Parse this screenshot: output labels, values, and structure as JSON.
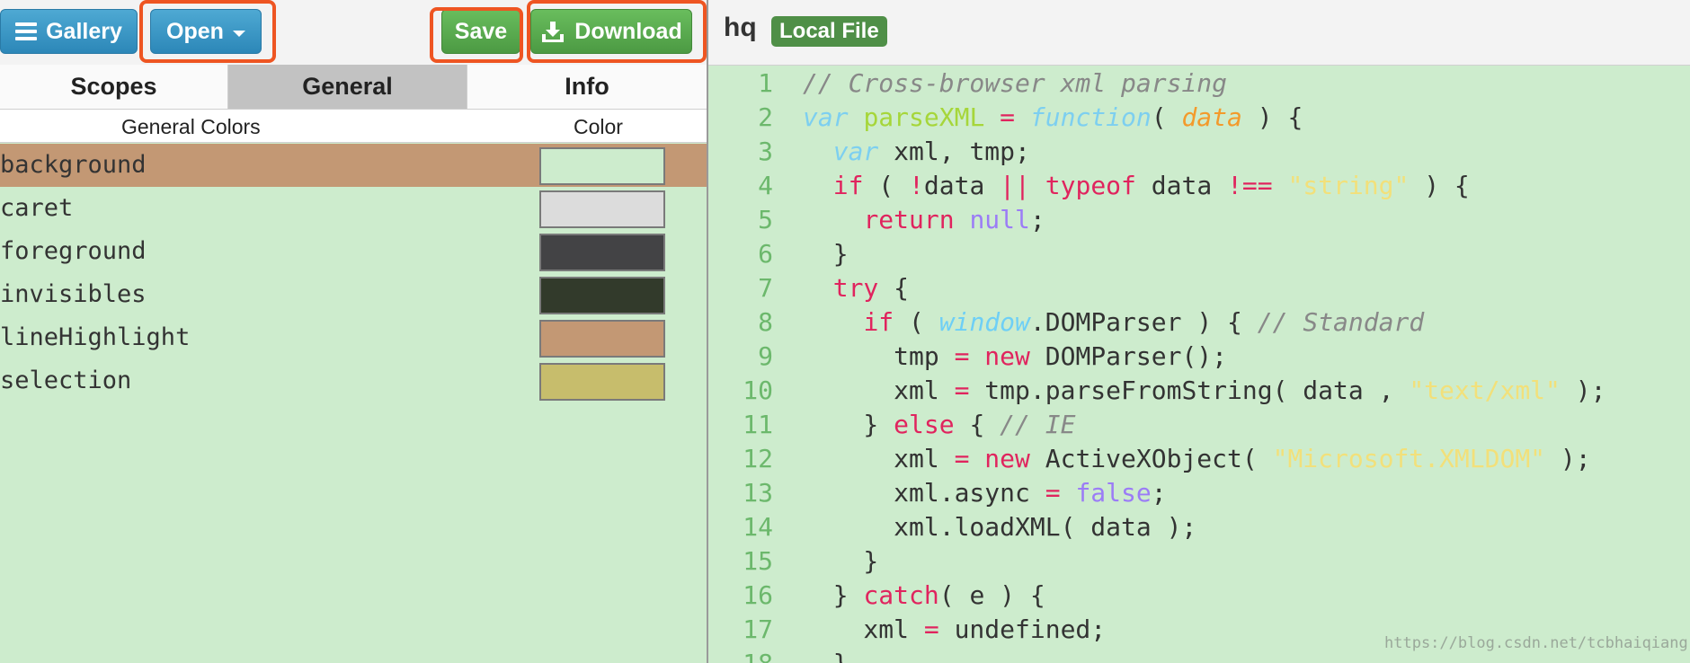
{
  "toolbar": {
    "gallery_label": "Gallery",
    "open_label": "Open",
    "save_label": "Save",
    "download_label": "Download"
  },
  "header": {
    "title": "hq",
    "badge": "Local File"
  },
  "tabs": [
    {
      "label": "Scopes"
    },
    {
      "label": "General"
    },
    {
      "label": "Info"
    }
  ],
  "table": {
    "col_name": "General Colors",
    "col_color": "Color",
    "rows": [
      {
        "name": "background",
        "color": "#cdeccd"
      },
      {
        "name": "caret",
        "color": "#dcdcdc"
      },
      {
        "name": "foreground",
        "color": "#434345"
      },
      {
        "name": "invisibles",
        "color": "#323a2b"
      },
      {
        "name": "lineHighlight",
        "color": "#c39874"
      },
      {
        "name": "selection",
        "color": "#c7bd6c"
      }
    ]
  },
  "code": [
    [
      [
        "comment",
        "// Cross-browser xml parsing"
      ]
    ],
    [
      [
        "storage",
        "var"
      ],
      [
        "plain",
        " "
      ],
      [
        "function",
        "parseXML"
      ],
      [
        "plain",
        " "
      ],
      [
        "operator",
        "="
      ],
      [
        "plain",
        " "
      ],
      [
        "storage",
        "function"
      ],
      [
        "plain",
        "( "
      ],
      [
        "param",
        "data"
      ],
      [
        "plain",
        " ) {"
      ]
    ],
    [
      [
        "plain",
        "  "
      ],
      [
        "storage",
        "var"
      ],
      [
        "plain",
        " xml, tmp;"
      ]
    ],
    [
      [
        "plain",
        "  "
      ],
      [
        "keyword",
        "if"
      ],
      [
        "plain",
        " ( "
      ],
      [
        "operator",
        "!"
      ],
      [
        "plain",
        "data "
      ],
      [
        "operator",
        "||"
      ],
      [
        "plain",
        " "
      ],
      [
        "keyword",
        "typeof"
      ],
      [
        "plain",
        " data "
      ],
      [
        "operator",
        "!=="
      ],
      [
        "plain",
        " "
      ],
      [
        "string",
        "\"string\""
      ],
      [
        "plain",
        " ) {"
      ]
    ],
    [
      [
        "plain",
        "    "
      ],
      [
        "keyword",
        "return"
      ],
      [
        "plain",
        " "
      ],
      [
        "constant",
        "null"
      ],
      [
        "plain",
        ";"
      ]
    ],
    [
      [
        "plain",
        "  }"
      ]
    ],
    [
      [
        "plain",
        "  "
      ],
      [
        "keyword",
        "try"
      ],
      [
        "plain",
        " {"
      ]
    ],
    [
      [
        "plain",
        "    "
      ],
      [
        "keyword",
        "if"
      ],
      [
        "plain",
        " ( "
      ],
      [
        "builtin",
        "window"
      ],
      [
        "plain",
        ".DOMParser ) { "
      ],
      [
        "comment",
        "// Standard"
      ]
    ],
    [
      [
        "plain",
        "      tmp "
      ],
      [
        "operator",
        "="
      ],
      [
        "plain",
        " "
      ],
      [
        "keyword",
        "new"
      ],
      [
        "plain",
        " DOMParser();"
      ]
    ],
    [
      [
        "plain",
        "      xml "
      ],
      [
        "operator",
        "="
      ],
      [
        "plain",
        " tmp.parseFromString( data , "
      ],
      [
        "string",
        "\"text/xml\""
      ],
      [
        "plain",
        " );"
      ]
    ],
    [
      [
        "plain",
        "    } "
      ],
      [
        "keyword",
        "else"
      ],
      [
        "plain",
        " { "
      ],
      [
        "comment",
        "// IE"
      ]
    ],
    [
      [
        "plain",
        "      xml "
      ],
      [
        "operator",
        "="
      ],
      [
        "plain",
        " "
      ],
      [
        "keyword",
        "new"
      ],
      [
        "plain",
        " ActiveXObject( "
      ],
      [
        "string",
        "\"Microsoft.XMLDOM\""
      ],
      [
        "plain",
        " );"
      ]
    ],
    [
      [
        "plain",
        "      xml.async "
      ],
      [
        "operator",
        "="
      ],
      [
        "plain",
        " "
      ],
      [
        "constant",
        "false"
      ],
      [
        "plain",
        ";"
      ]
    ],
    [
      [
        "plain",
        "      xml.loadXML( data );"
      ]
    ],
    [
      [
        "plain",
        "    }"
      ]
    ],
    [
      [
        "plain",
        "  } "
      ],
      [
        "keyword",
        "catch"
      ],
      [
        "plain",
        "( e ) {"
      ]
    ],
    [
      [
        "plain",
        "    xml "
      ],
      [
        "operator",
        "="
      ],
      [
        "plain",
        " undefined;"
      ]
    ],
    [
      [
        "plain",
        "  }"
      ]
    ]
  ],
  "watermark": "https://blog.csdn.net/tcbhaiqiang"
}
